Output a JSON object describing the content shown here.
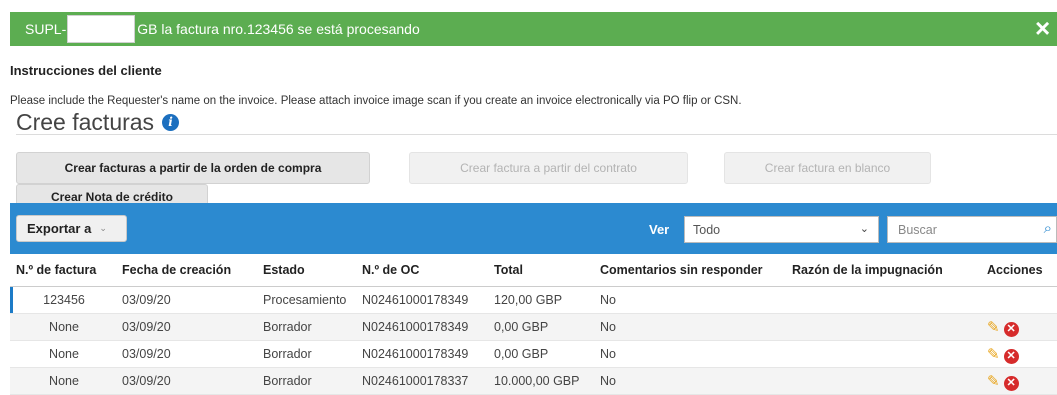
{
  "banner": {
    "prefix": "SUPL-",
    "message": "GB la factura nro.123456 se está procesando",
    "close_icon": "×"
  },
  "instructions": {
    "title": "Instrucciones del cliente",
    "text": "Please include the Requester's name on the invoice. Please attach invoice image scan if you create an invoice electronically via PO flip or CSN."
  },
  "section": {
    "title": "Cree facturas",
    "info_icon": "i"
  },
  "buttons": {
    "from_po": "Crear facturas a partir de la orden de compra",
    "from_contract": "Crear factura a partir del contrato",
    "blank": "Crear factura en blanco",
    "credit_note": "Crear Nota de crédito"
  },
  "toolbar": {
    "export_label": "Exportar a",
    "view_label": "Ver",
    "view_value": "Todo",
    "search_placeholder": "Buscar"
  },
  "table": {
    "columns": [
      "N.º de factura",
      "Fecha de creación",
      "Estado",
      "N.º de OC",
      "Total",
      "Comentarios sin responder",
      "Razón de la impugnación",
      "Acciones"
    ],
    "rows": [
      {
        "invoice": "123456",
        "date": "03/09/20",
        "status": "Procesamiento",
        "po": "N02461000178349",
        "total": "120,00 GBP",
        "comments": "No",
        "dispute": "",
        "actions": false
      },
      {
        "invoice": "None",
        "date": "03/09/20",
        "status": "Borrador",
        "po": "N02461000178349",
        "total": "0,00 GBP",
        "comments": "No",
        "dispute": "",
        "actions": true
      },
      {
        "invoice": "None",
        "date": "03/09/20",
        "status": "Borrador",
        "po": "N02461000178349",
        "total": "0,00 GBP",
        "comments": "No",
        "dispute": "",
        "actions": true
      },
      {
        "invoice": "None",
        "date": "03/09/20",
        "status": "Borrador",
        "po": "N02461000178337",
        "total": "10.000,00 GBP",
        "comments": "No",
        "dispute": "",
        "actions": true
      }
    ]
  },
  "colors": {
    "banner": "#5cad51",
    "toolbar": "#2c8ad0",
    "link": "#1c7bc7",
    "edit_icon": "#e8a317",
    "delete_icon": "#d62b2b"
  }
}
